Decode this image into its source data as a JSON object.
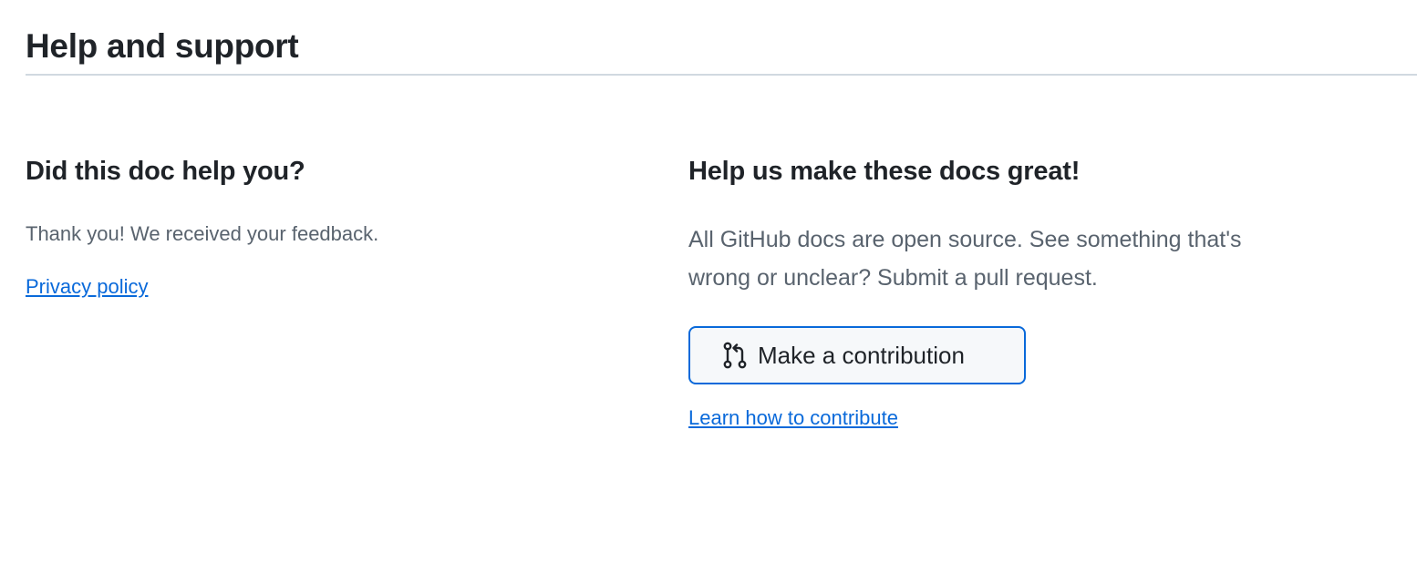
{
  "section": {
    "title": "Help and support"
  },
  "feedback": {
    "heading": "Did this doc help you?",
    "message": "Thank you! We received your feedback.",
    "privacy_link": "Privacy policy"
  },
  "contribute": {
    "heading": "Help us make these docs great!",
    "description": "All GitHub docs are open source. See something that's wrong or unclear? Submit a pull request.",
    "button_label": "Make a contribution",
    "button_icon": "git-pull-request-icon",
    "learn_link": "Learn how to contribute"
  },
  "colors": {
    "link": "#0969da",
    "muted_text": "#59636e",
    "heading_text": "#1f2328",
    "divider": "#d1d9e0",
    "button_bg": "#f6f8fa"
  }
}
